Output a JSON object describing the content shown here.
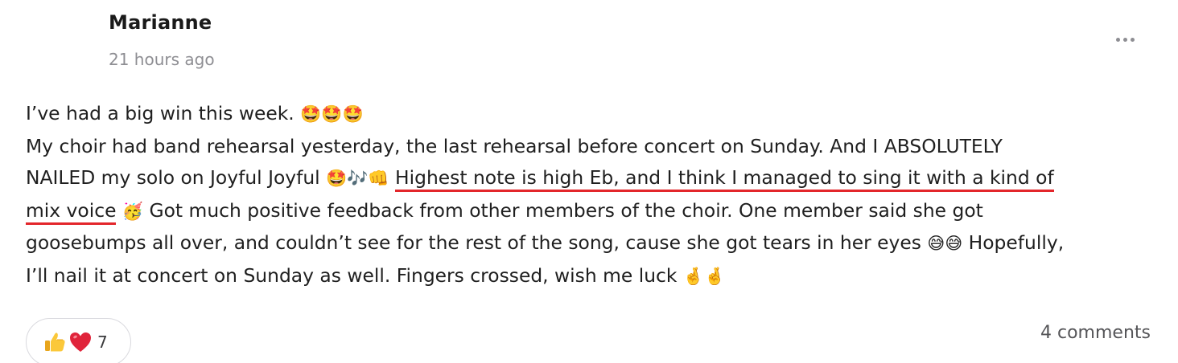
{
  "post": {
    "author": "Marianne",
    "timestamp": "21 hours ago",
    "more_icon": "more-horizontal-icon",
    "lines": [
      {
        "text_a": "I’ve had a big win this week. ",
        "emoji_a": "🤩🤩🤩"
      },
      {
        "text_a": "My choir had band rehearsal yesterday, the last rehearsal before concert on Sunday. And I ABSOLUTELY"
      },
      {
        "text_a": "NAILED my solo on Joyful Joyful ",
        "emoji_a": "🤩🎶👊",
        "highlight": "Highest note is high Eb, and I think I managed to sing it with a kind of"
      },
      {
        "highlight": "mix voice",
        "emoji_a": "🥳",
        "text_a": " Got much positive feedback from other members of the choir. One member said she got"
      },
      {
        "text_a": "goosebumps all over, and couldn’t see for the rest of the song, cause she got tears in her eyes ",
        "emoji_a": "😅😅",
        "text_b": " Hopefully,"
      },
      {
        "text_a": "I’ll nail it at concert on Sunday as well. Fingers crossed, wish me luck ",
        "emoji_a": "🤞🤞"
      }
    ],
    "highlight_color": "#e3262b"
  },
  "footer": {
    "reactions": {
      "icons": [
        "thumbs-up-icon",
        "heart-icon"
      ],
      "count": "7"
    },
    "comments_label": "4 comments"
  }
}
